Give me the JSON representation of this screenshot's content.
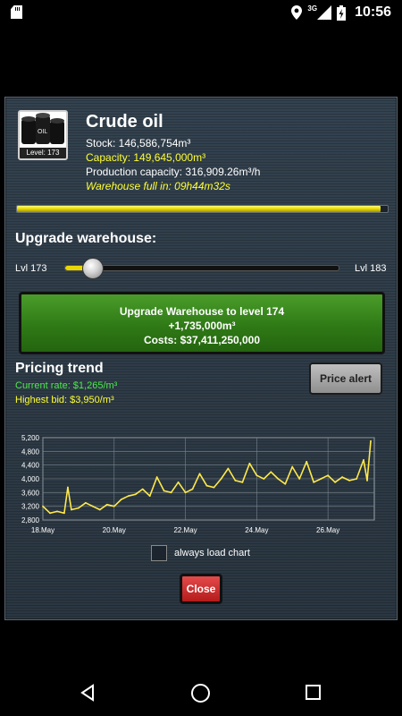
{
  "status_bar": {
    "time": "10:56",
    "network": "3G",
    "icons": [
      "sd-card-icon",
      "location-icon",
      "signal-icon",
      "battery-icon"
    ]
  },
  "resource": {
    "name": "Crude oil",
    "icon": "oil-barrels-icon",
    "icon_text": "OIL",
    "level_badge": "Level: 173",
    "stock": "Stock: 146,586,754m³",
    "capacity": "Capacity: 149,645,000m³",
    "production": "Production capacity: 316,909.26m³/h",
    "warehouse_full": "Warehouse full in: 09h44m32s",
    "fill_fraction": 0.98
  },
  "upgrade": {
    "heading": "Upgrade warehouse:",
    "lvl_min": "Lvl 173",
    "lvl_max": "Lvl 183",
    "slider_fraction": 0.1,
    "button_line1": "Upgrade Warehouse to level 174",
    "button_line2": "+1,735,000m³",
    "button_line3": "Costs: $37,411,250,000"
  },
  "pricing": {
    "heading": "Pricing trend",
    "current_rate": "Current rate: $1,265/m³",
    "highest_bid": "Highest bid:  $3,950/m³",
    "price_alert_label": "Price alert"
  },
  "chart_data": {
    "type": "line",
    "title": "",
    "xlabel": "",
    "ylabel": "",
    "ylim": [
      2800,
      5200
    ],
    "yticks": [
      "5,200",
      "4,800",
      "4,400",
      "4,000",
      "3,600",
      "3,200",
      "2,800"
    ],
    "ytick_values": [
      5200,
      4800,
      4400,
      4000,
      3600,
      3200,
      2800
    ],
    "xlim": [
      18,
      27.3
    ],
    "xticks": [
      "18.May",
      "20.May",
      "22.May",
      "24.May",
      "26.May"
    ],
    "xtick_values": [
      18,
      20,
      22,
      24,
      26
    ],
    "grid": true,
    "line_color": "#ffe94a",
    "series": [
      {
        "x": [
          18.0,
          18.2,
          18.4,
          18.6,
          18.7,
          18.8,
          19.0,
          19.2,
          19.4,
          19.6,
          19.8,
          20.0,
          20.2,
          20.4,
          20.6,
          20.8,
          21.0,
          21.2,
          21.4,
          21.6,
          21.8,
          22.0,
          22.2,
          22.4,
          22.6,
          22.8,
          23.0,
          23.2,
          23.4,
          23.6,
          23.8,
          24.0,
          24.2,
          24.4,
          24.6,
          24.8,
          25.0,
          25.2,
          25.4,
          25.6,
          25.8,
          26.0,
          26.2,
          26.4,
          26.6,
          26.8,
          27.0,
          27.1,
          27.2
        ],
        "y": [
          3200,
          3000,
          3050,
          3000,
          3750,
          3100,
          3150,
          3300,
          3200,
          3100,
          3250,
          3200,
          3400,
          3500,
          3550,
          3700,
          3500,
          4050,
          3650,
          3600,
          3900,
          3600,
          3700,
          4150,
          3800,
          3750,
          4000,
          4300,
          3950,
          3900,
          4450,
          4100,
          4000,
          4200,
          4000,
          3850,
          4350,
          4000,
          4500,
          3900,
          4000,
          4100,
          3900,
          4050,
          3950,
          4000,
          4550,
          3950,
          5100
        ]
      }
    ]
  },
  "footer": {
    "checkbox_label": "always load chart",
    "close_label": "Close"
  }
}
